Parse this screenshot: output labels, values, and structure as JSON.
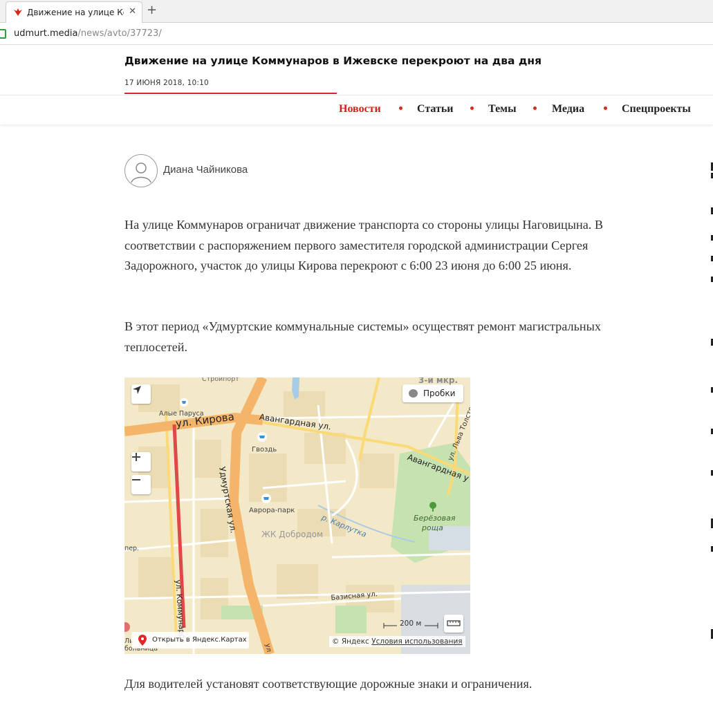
{
  "browser": {
    "tab_title": "Движение на улице Комм",
    "new_tab_symbol": "+",
    "close_symbol": "✕",
    "url_host": "udmurt.media",
    "url_path": "/news/avto/37723/"
  },
  "article": {
    "title": "Движение на улице Коммунаров в Ижевске перекроют на два дня",
    "date": "17 ИЮНЯ 2018, 10:10",
    "author": "Диана Чайникова",
    "paragraphs": [
      "На улице Коммунаров ограничат движение транспорта со стороны улицы Наговицына. В соответствии с распоряжением первого заместителя городской администрации Сергея Задорожного, участок до улицы Кирова перекроют с 6:00 23 июня до 6:00 25 июня.",
      "В этот период «Удмуртские коммунальные системы» осуществят ремонт магистральных теплосетей.",
      "Для водителей установят соответствующие дорожные знаки и ограничения."
    ]
  },
  "nav": {
    "items": [
      "Новости",
      "Статьи",
      "Темы",
      "Медиа",
      "Спецпроекты"
    ],
    "active": "Новости",
    "accent": "#d52b1e"
  },
  "map": {
    "traffic_label": "Пробки",
    "open_link": "Открыть в Яндекс.Картах",
    "copyright": "© Яндекс",
    "terms": "Условия использования",
    "scale": "200 м",
    "labels": {
      "stroyport": "Стройпорт",
      "mkr": "3-й мкр.",
      "alye_parusa": "Алые Паруса",
      "kirova": "ул. Кирова",
      "avangardnaya": "Авангардная ул.",
      "avangardnaya2": "Авангардная у",
      "lva_tolstogo": "ул. Льва Толстого",
      "gvozd": "Гвоздь",
      "udmurtskaya": "Удмуртская ул.",
      "avrora": "Аврора-парк",
      "karlutka": "р. Карлутка",
      "dobrodom": "ЖК Добродом",
      "berezovaya": "Берёзовая",
      "roscha": "роща",
      "bazisnaya": "Базисная ул.",
      "kommunarov": "ул. Коммунаров",
      "per": "пер.",
      "bolnitsa": "больница",
      "bolnitsa_prefix": "Ль",
      "u_edge": "ул"
    }
  }
}
